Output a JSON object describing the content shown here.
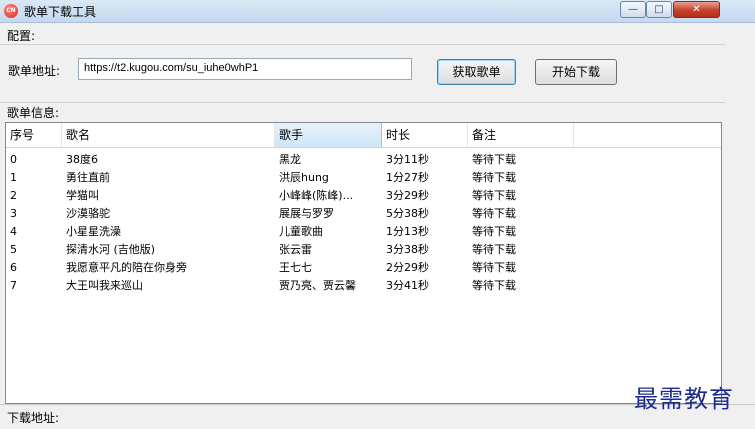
{
  "window": {
    "title": "歌单下载工具",
    "icon_text": "CN",
    "minimize": "—",
    "maximize": "□",
    "close": "✕"
  },
  "config": {
    "section_label": "配置:",
    "url_label": "歌单地址:",
    "url_value": "https://t2.kugou.com/su_iuhe0whP1",
    "fetch_button": "获取歌单",
    "download_button": "开始下载"
  },
  "info": {
    "section_label": "歌单信息:"
  },
  "table": {
    "columns": [
      "序号",
      "歌名",
      "歌手",
      "时长",
      "备注"
    ],
    "rows": [
      [
        "0",
        "38度6",
        "黑龙",
        "3分11秒",
        "等待下载"
      ],
      [
        "1",
        "勇往直前",
        "洪辰hung",
        "1分27秒",
        "等待下载"
      ],
      [
        "2",
        "学猫叫",
        "小峰峰(陈峰)...",
        "3分29秒",
        "等待下载"
      ],
      [
        "3",
        "沙漠骆驼",
        "展展与罗罗",
        "5分38秒",
        "等待下载"
      ],
      [
        "4",
        "小星星洗澡",
        "儿童歌曲",
        "1分13秒",
        "等待下载"
      ],
      [
        "5",
        "探清水河 (吉他版)",
        "张云雷",
        "3分38秒",
        "等待下载"
      ],
      [
        "6",
        "我愿意平凡的陪在你身旁",
        "王七七",
        "2分29秒",
        "等待下载"
      ],
      [
        "7",
        "大王叫我来巡山",
        "贾乃亮、贾云馨",
        "3分41秒",
        "等待下载"
      ]
    ]
  },
  "download": {
    "section_label": "下载地址:"
  },
  "watermark": "最需教育"
}
